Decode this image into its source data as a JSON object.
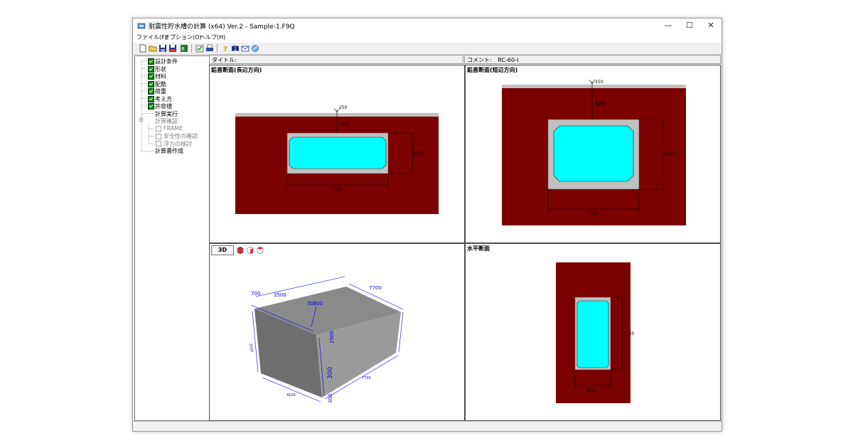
{
  "window": {
    "title": "耐震性貯水槽の計算 (x64) Ver.2 - Sample-1.F9Q",
    "minimize": "—",
    "maximize": "☐",
    "close": "✕"
  },
  "menu": [
    "ファイル(F)",
    "オプション(O)",
    "ヘルプ(H)"
  ],
  "toolbar_icons": [
    "new-file-icon",
    "open-folder-icon",
    "save-icon",
    "save-as-icon",
    "export-icon",
    "check-icon",
    "print-icon",
    "help-icon",
    "manual-icon",
    "email-icon",
    "website-icon"
  ],
  "tree": {
    "items": [
      {
        "label": "設計条件",
        "checked": true
      },
      {
        "label": "形状",
        "checked": true
      },
      {
        "label": "材料",
        "checked": true
      },
      {
        "label": "配筋",
        "checked": true
      },
      {
        "label": "荷重",
        "checked": true
      },
      {
        "label": "考え方",
        "checked": true
      },
      {
        "label": "許容値",
        "checked": true
      },
      {
        "label": "計算実行"
      },
      {
        "label": "計算確認",
        "expander": "⊟"
      },
      {
        "label": "FRAME"
      },
      {
        "label": "安全性の確認"
      },
      {
        "label": "浮力の検討"
      },
      {
        "label": "計算書作成"
      }
    ]
  },
  "header": {
    "title_label": "タイトル:",
    "comment_label": "コメント:",
    "comment_value": "RC-60-I"
  },
  "panes": {
    "long_section": {
      "title": "鉛直断面(長辺方向)",
      "dims": {
        "cover_top": "250",
        "soil_depth": "1250",
        "height": "3150",
        "width": "7700"
      }
    },
    "short_section": {
      "title": "鉛直断面(短辺方向)",
      "dims": {
        "cover_top": "250",
        "soil_depth": "1250",
        "height": "3150",
        "width": "4100"
      }
    },
    "view3d": {
      "button": "3D",
      "dims": [
        "700",
        "3500",
        "7700",
        "300",
        "300",
        "2500",
        "300",
        "4100",
        "7700",
        "300",
        "3500"
      ]
    },
    "plan": {
      "title": "水平断面",
      "dims": {
        "length": "7700",
        "width": "4100"
      }
    }
  },
  "colors": {
    "soil": "#7b0000",
    "concrete": "#c0c0c0",
    "water": "#00ffff",
    "dim_blue": "#0000ee"
  }
}
